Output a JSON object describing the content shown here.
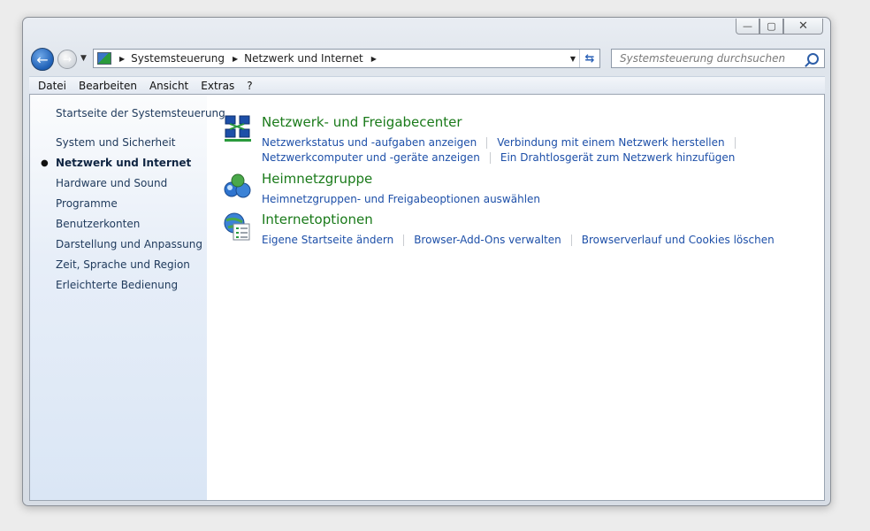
{
  "window": {
    "buttons": {
      "minimize": "—",
      "maximize": "▢",
      "close": "✕"
    }
  },
  "nav": {
    "back_glyph": "←",
    "forward_glyph": "→",
    "dropdown_glyph": "▼"
  },
  "address": {
    "crumbs": [
      "Systemsteuerung",
      "Netzwerk und Internet"
    ],
    "sep_glyph": "▶",
    "dropdown_glyph": "▼",
    "refresh_glyph": "⇆"
  },
  "search": {
    "placeholder": "Systemsteuerung durchsuchen"
  },
  "menu": [
    "Datei",
    "Bearbeiten",
    "Ansicht",
    "Extras",
    "?"
  ],
  "sidebar": {
    "home": "Startseite der Systemsteuerung",
    "bullet": "●",
    "items": [
      {
        "label": "System und Sicherheit",
        "active": false
      },
      {
        "label": "Netzwerk und Internet",
        "active": true
      },
      {
        "label": "Hardware und Sound",
        "active": false
      },
      {
        "label": "Programme",
        "active": false
      },
      {
        "label": "Benutzerkonten",
        "active": false
      },
      {
        "label": "Darstellung und Anpassung",
        "active": false
      },
      {
        "label": "Zeit, Sprache und Region",
        "active": false
      },
      {
        "label": "Erleichterte Bedienung",
        "active": false
      }
    ]
  },
  "categories": [
    {
      "title": "Netzwerk- und Freigabecenter",
      "icon": "network-center-icon",
      "rows": [
        [
          "Netzwerkstatus und -aufgaben anzeigen",
          "Verbindung mit einem Netzwerk herstellen"
        ],
        [
          "Netzwerkcomputer und -geräte anzeigen",
          "Ein Drahtlosgerät zum Netzwerk hinzufügen"
        ]
      ]
    },
    {
      "title": "Heimnetzgruppe",
      "icon": "homegroup-icon",
      "rows": [
        [
          "Heimnetzgruppen- und Freigabeoptionen auswählen"
        ]
      ]
    },
    {
      "title": "Internetoptionen",
      "icon": "internet-options-icon",
      "rows": [
        [
          "Eigene Startseite ändern",
          "Browser-Add-Ons verwalten",
          "Browserverlauf und Cookies löschen"
        ]
      ]
    }
  ],
  "colors": {
    "category_title": "#1a7a1a",
    "task_link": "#1d4fa8",
    "sidebar_text": "#1e395b"
  }
}
